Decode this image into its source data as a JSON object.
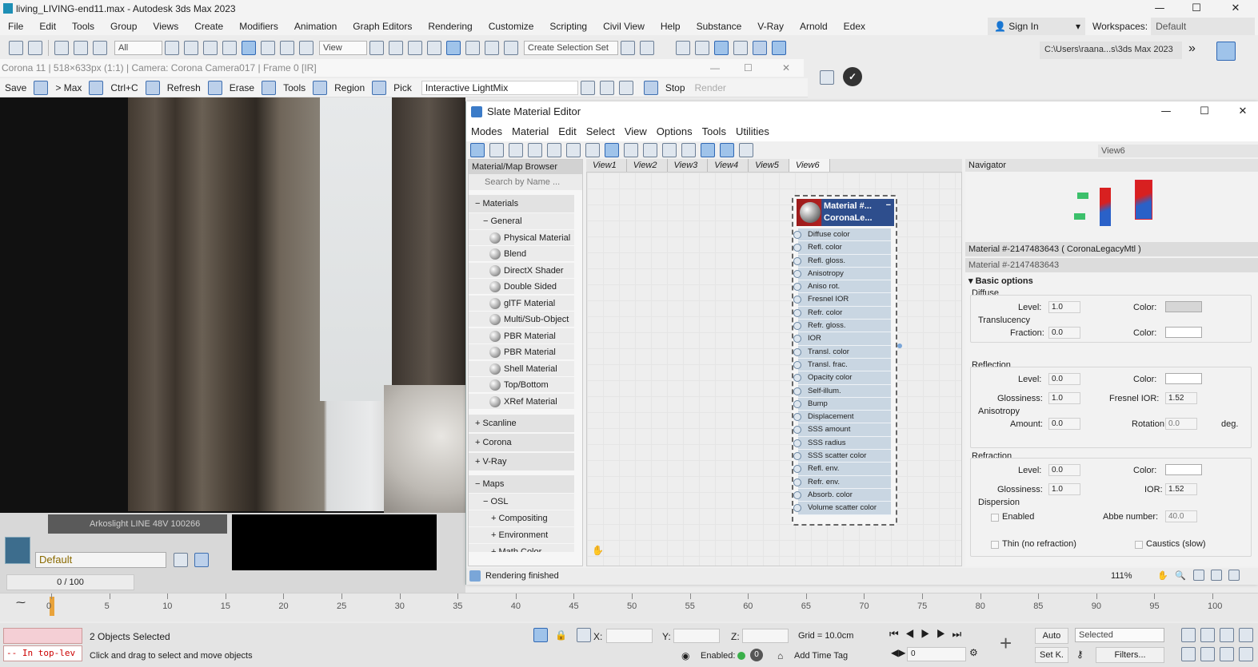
{
  "app": {
    "title": "living_LIVING-end11.max - Autodesk 3ds Max 2023"
  },
  "menu": [
    "File",
    "Edit",
    "Tools",
    "Group",
    "Views",
    "Create",
    "Modifiers",
    "Animation",
    "Graph Editors",
    "Rendering",
    "Customize",
    "Scripting",
    "Civil View",
    "Help",
    "Substance",
    "V-Ray",
    "Arnold",
    "Edex"
  ],
  "account": {
    "sign_in": "Sign In",
    "workspaces_label": "Workspaces:",
    "workspaces_value": "Default"
  },
  "toolbar": {
    "filter": "All",
    "view_dropdown": "View",
    "selection_set": "Create Selection Set",
    "path": "C:\\Users\\raana...s\\3ds Max 2023"
  },
  "corona": {
    "title": "Corona 11 | 518×633px (1:1) | Camera: Corona Camera017 | Frame 0 [IR]",
    "buttons": [
      "Save",
      "> Max",
      "Ctrl+C",
      "Refresh",
      "Erase",
      "Tools",
      "Region",
      "Pick"
    ],
    "lightmix": "Interactive LightMix",
    "stop": "Stop",
    "render": "Render"
  },
  "viewport": {
    "object_row": "Arkoslight LINE 48V 100266",
    "layer": "Default",
    "frames": "0 / 100"
  },
  "timeline": {
    "ticks": [
      "0",
      "5",
      "10",
      "15",
      "20",
      "25",
      "30",
      "35",
      "40",
      "45",
      "50",
      "55",
      "60",
      "65",
      "70",
      "75",
      "80",
      "85",
      "90",
      "95",
      "100"
    ]
  },
  "status": {
    "input_line": "-- In top-lev",
    "selected": "2 Objects Selected",
    "prompt": "Click and drag to select and move objects",
    "x_label": "X:",
    "y_label": "Y:",
    "z_label": "Z:",
    "grid": "Grid = 10.0cm",
    "enabled_label": "Enabled:",
    "add_time_tag": "Add Time Tag",
    "auto": "Auto",
    "set_key": "Set K.",
    "selected_dropdown": "Selected",
    "frame_value": "0",
    "filters": "Filters..."
  },
  "slate": {
    "title": "Slate Material Editor",
    "menu": [
      "Modes",
      "Material",
      "Edit",
      "Select",
      "View",
      "Options",
      "Tools",
      "Utilities"
    ],
    "view_select": "View6",
    "browser": {
      "header": "Material/Map Browser",
      "search_placeholder": "Search by Name ...",
      "materials": "Materials",
      "general": "General",
      "items": [
        "Physical Material",
        "Blend",
        "DirectX Shader",
        "Double Sided",
        "glTF Material",
        "Multi/Sub-Object",
        "PBR Material (M...",
        "PBR Material (S...",
        "Shell Material",
        "Top/Bottom",
        "XRef Material"
      ],
      "scanline": "Scanline",
      "corona": "Corona",
      "vray": "V-Ray",
      "maps": "Maps",
      "osl": "OSL",
      "compositing": "Compositing",
      "environment": "Environment",
      "math_color": "Math Color"
    },
    "view_tabs": [
      "View1",
      "View2",
      "View3",
      "View4",
      "View5",
      "View6"
    ],
    "node": {
      "title1": "Material #...",
      "title2": "CoronaLe...",
      "slots": [
        "Diffuse color",
        "Refl. color",
        "Refl. gloss.",
        "Anisotropy",
        "Aniso rot.",
        "Fresnel IOR",
        "Refr. color",
        "Refr. gloss.",
        "IOR",
        "Transl. color",
        "Transl. frac.",
        "Opacity color",
        "Self-illum.",
        "Bump",
        "Displacement",
        "SSS amount",
        "SSS radius",
        "SSS scatter color",
        "Refl. env.",
        "Refr. env.",
        "Absorb. color",
        "Volume scatter color"
      ]
    },
    "navigator": "Navigator",
    "params": {
      "header": "Material #-2147483643  ( CoronaLegacyMtl )",
      "name": "Material #-2147483643",
      "rollout": "Basic options",
      "diffuse": "Diffuse",
      "level_label": "Level:",
      "color_label": "Color:",
      "diffuse_level": "1.0",
      "translucency": "Translucency",
      "fraction_label": "Fraction:",
      "fraction": "0.0",
      "reflection": "Reflection",
      "refl_level": "0.0",
      "glossiness_label": "Glossiness:",
      "refl_gloss": "1.0",
      "fresnel_label": "Fresnel IOR:",
      "fresnel": "1.52",
      "anisotropy": "Anisotropy",
      "amount_label": "Amount:",
      "amount": "0.0",
      "rotation_label": "Rotation:",
      "rotation": "0.0",
      "deg": "deg.",
      "refraction": "Refraction",
      "refr_level": "0.0",
      "refr_gloss": "1.0",
      "ior_label": "IOR:",
      "ior": "1.52",
      "dispersion": "Dispersion",
      "enabled": "Enabled",
      "abbe_label": "Abbe number:",
      "abbe": "40.0",
      "thin": "Thin (no refraction)",
      "caustics": "Caustics (slow)",
      "diffuse_color": "#d6d6d6"
    },
    "status": "Rendering finished",
    "zoom": "111%"
  }
}
